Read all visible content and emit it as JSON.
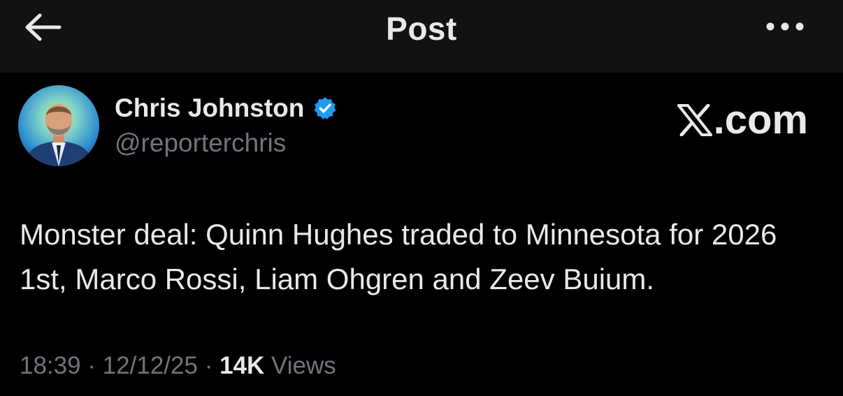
{
  "header": {
    "title": "Post",
    "back_icon": "arrow-left-icon",
    "more_icon": "more-horizontal-icon"
  },
  "author": {
    "name": "Chris Johnston",
    "handle": "@reporterchris",
    "verified": true,
    "verified_color": "#1d9bf0"
  },
  "brand": {
    "label": ".com",
    "icon": "x-logo-icon"
  },
  "post": {
    "text": "Monster deal: Quinn Hughes traded to Minnesota for 2026 1st, Marco Rossi, Liam Ohgren and Zeev Buium.",
    "time": "18:39",
    "separator": "·",
    "date": "12/12/25",
    "views_count": "14K",
    "views_label": "Views"
  },
  "colors": {
    "background": "#000000",
    "header_background": "#121212",
    "text_primary": "#e7e9ea",
    "text_secondary": "#71767b"
  }
}
